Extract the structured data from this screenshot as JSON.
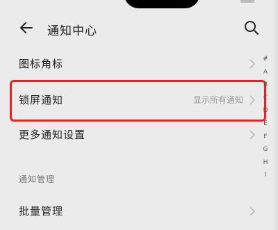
{
  "header": {
    "title": "通知中心",
    "back_icon": "arrow-left-icon",
    "search_icon": "search-icon"
  },
  "rows": [
    {
      "label": "图标角标",
      "value": ""
    },
    {
      "label": "锁屏通知",
      "value": "显示所有通知"
    },
    {
      "label": "更多通知设置",
      "value": ""
    }
  ],
  "section": {
    "label": "通知管理"
  },
  "manage_row": {
    "label": "批量管理"
  },
  "index_letters": [
    "#",
    "A",
    "B",
    "C",
    "D",
    "E",
    "F",
    "G",
    "H",
    "I"
  ],
  "colors": {
    "background": "#ebebeb",
    "highlight": "#f02020",
    "text": "#222222",
    "secondary_text": "#999999"
  }
}
